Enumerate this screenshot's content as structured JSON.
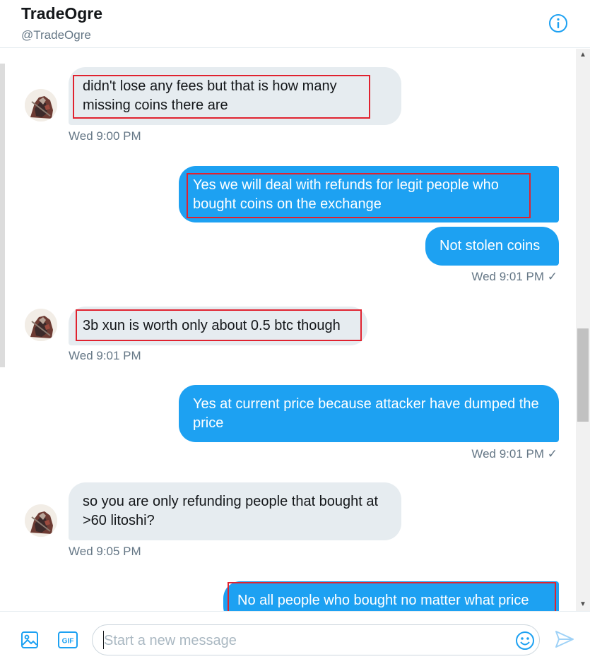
{
  "header": {
    "name": "TradeOgre",
    "handle": "@TradeOgre"
  },
  "messages": [
    {
      "side": "in",
      "text": "didn't lose any fees but that is how many missing coins there are",
      "time": "Wed 9:00 PM"
    },
    {
      "side": "out",
      "text": "Yes we will deal with refunds for legit people who bought coins on the exchange"
    },
    {
      "side": "out",
      "text": "Not stolen coins",
      "time": "Wed 9:01 PM ✓"
    },
    {
      "side": "in",
      "text": "3b xun is worth only about 0.5 btc though",
      "time": "Wed 9:01 PM"
    },
    {
      "side": "out",
      "text": "Yes at current price because attacker have dumped the price",
      "time": "Wed 9:01 PM ✓"
    },
    {
      "side": "in",
      "text": "so you are only refunding people that bought at >60 litoshi?",
      "time": "Wed 9:05 PM"
    },
    {
      "side": "out",
      "text": "No all people who bought no matter what price"
    }
  ],
  "composer": {
    "placeholder": "Start a new message",
    "gif_label": "GIF"
  },
  "icons": [
    "info-icon",
    "image-icon",
    "gif-icon",
    "emoji-icon",
    "send-icon",
    "avatar"
  ],
  "colors": {
    "accent": "#1da1f2",
    "incoming_bubble": "#e6ecf0",
    "highlight_box": "#e0222f"
  }
}
